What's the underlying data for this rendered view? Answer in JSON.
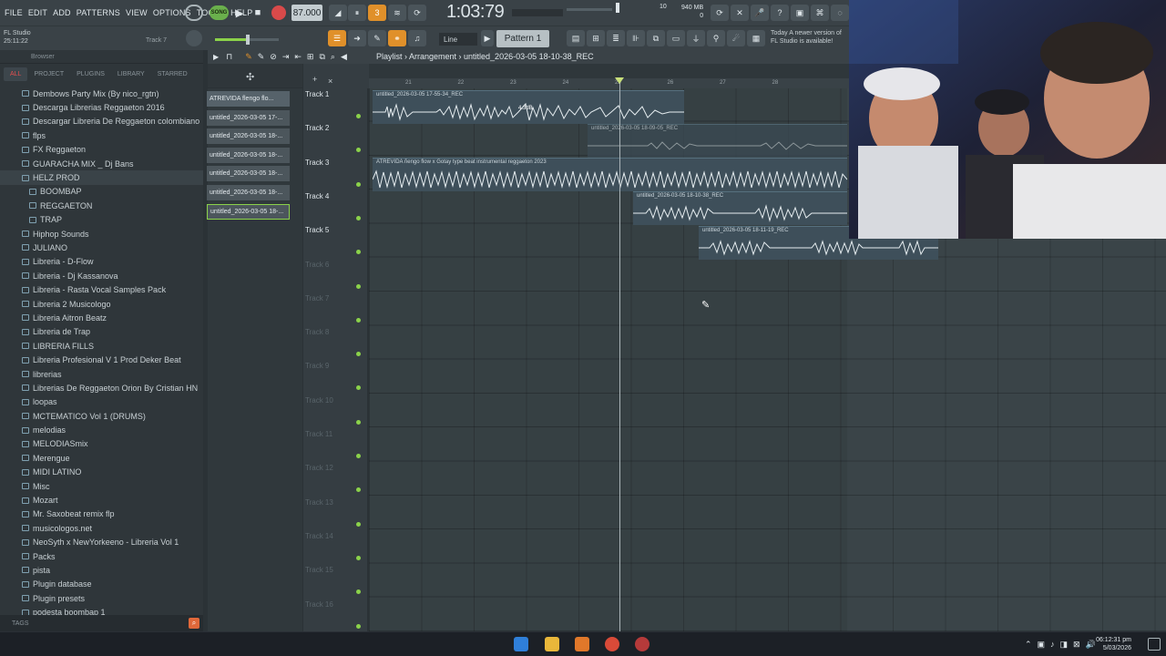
{
  "menu": [
    "FILE",
    "EDIT",
    "ADD",
    "PATTERNS",
    "VIEW",
    "OPTIONS",
    "TOOLS",
    "HELP"
  ],
  "transport": {
    "song_label": "SONG",
    "tempo": "87.000",
    "time": "1:03:79"
  },
  "monitor": {
    "cpu": "10",
    "memory": "940 MB",
    "memory2": "0"
  },
  "project": {
    "name": "FL Studio",
    "elapsed": "25:11:22",
    "hint_track": "Track 7"
  },
  "snap": {
    "value": "Line"
  },
  "pattern": {
    "label": "Pattern 1"
  },
  "update_hint": {
    "line1": "Today  A newer version of",
    "line2": "FL Studio is available!"
  },
  "browser": {
    "title": "Browser",
    "tabs": [
      "ALL",
      "PROJECT",
      "PLUGINS",
      "LIBRARY",
      "STARRED"
    ],
    "folders": [
      {
        "name": "Dembows Party Mix (By nico_rgtn)",
        "sub": false
      },
      {
        "name": "Descarga Librerias Reggaeton 2016",
        "sub": false
      },
      {
        "name": "Descargar Libreria  De Reggaeton colombiano",
        "sub": false
      },
      {
        "name": "flps",
        "sub": false
      },
      {
        "name": "FX Reggaeton",
        "sub": false
      },
      {
        "name": "GUARACHA MIX _ Dj Bans",
        "sub": false
      },
      {
        "name": "HELZ PROD",
        "sub": false,
        "selected": true
      },
      {
        "name": "BOOMBAP",
        "sub": true
      },
      {
        "name": "REGGAETON",
        "sub": true
      },
      {
        "name": "TRAP",
        "sub": true
      },
      {
        "name": "Hiphop Sounds",
        "sub": false
      },
      {
        "name": "JULIANO",
        "sub": false
      },
      {
        "name": "Libreria - D-Flow",
        "sub": false
      },
      {
        "name": "Libreria - Dj Kassanova",
        "sub": false
      },
      {
        "name": "Libreria - Rasta Vocal Samples Pack",
        "sub": false
      },
      {
        "name": "Libreria 2 Musicologo",
        "sub": false
      },
      {
        "name": "Libreria Aitron Beatz",
        "sub": false
      },
      {
        "name": "Libreria de Trap",
        "sub": false
      },
      {
        "name": "LIBRERIA FILLS",
        "sub": false
      },
      {
        "name": "Libreria Profesional V 1 Prod Deker Beat",
        "sub": false
      },
      {
        "name": "librerias",
        "sub": false
      },
      {
        "name": "Librerias De Reggaeton Orion By Cristian HN",
        "sub": false
      },
      {
        "name": "loopas",
        "sub": false
      },
      {
        "name": "MCTEMATICO Vol 1 (DRUMS)",
        "sub": false
      },
      {
        "name": "melodias",
        "sub": false
      },
      {
        "name": "MELODIASmix",
        "sub": false
      },
      {
        "name": "Merengue",
        "sub": false
      },
      {
        "name": "MIDI LATINO",
        "sub": false
      },
      {
        "name": "Misc",
        "sub": false
      },
      {
        "name": "Mozart",
        "sub": false
      },
      {
        "name": "Mr. Saxobeat remix flp",
        "sub": false
      },
      {
        "name": "musicologos.net",
        "sub": false
      },
      {
        "name": "NeoSyth x NewYorkeeno - Libreria Vol 1",
        "sub": false
      },
      {
        "name": "Packs",
        "sub": false
      },
      {
        "name": "pista",
        "sub": false
      },
      {
        "name": "Plugin database",
        "sub": false
      },
      {
        "name": "Plugin presets",
        "sub": false
      },
      {
        "name": "podesta boombap 1",
        "sub": false
      }
    ],
    "tags_label": "TAGS"
  },
  "clips": [
    "ATREVIDA flengo flo...",
    "untitled_2026-03-05 17-...",
    "untitled_2026-03-05 18-...",
    "untitled_2026-03-05 18-...",
    "untitled_2026-03-05 18-...",
    "untitled_2026-03-05 18-...",
    "untitled_2026-03-05 18-..."
  ],
  "playlist": {
    "breadcrumb": "Playlist › Arrangement › untitled_2026-03-05 18-10-38_REC",
    "ruler": [
      "21",
      "22",
      "23",
      "24",
      "25",
      "26",
      "27",
      "28"
    ],
    "tracks": [
      "Track 1",
      "Track 2",
      "Track 3",
      "Track 4",
      "Track 5",
      "Track 6",
      "Track 7",
      "Track 8",
      "Track 9",
      "Track 10",
      "Track 11",
      "Track 12",
      "Track 13",
      "Track 14",
      "Track 15",
      "Track 16"
    ],
    "audio_clips": [
      {
        "label": "untitled_2026-03-05 17-55-34_REC",
        "volume": "4.3dB"
      },
      {
        "label": "untitled_2026-03-05 18-09-05_REC"
      },
      {
        "label": "ATREVIDA ñengo flow x Gotay type beat  instrumental reggaeton 2023"
      },
      {
        "label": "untitled_2026-03-05 18-10-38_REC"
      },
      {
        "label": "untitled_2026-03-05 18-11-19_REC"
      }
    ]
  },
  "taskbar": {
    "time": "06:12:31 pm",
    "date": "5/03/2026"
  }
}
